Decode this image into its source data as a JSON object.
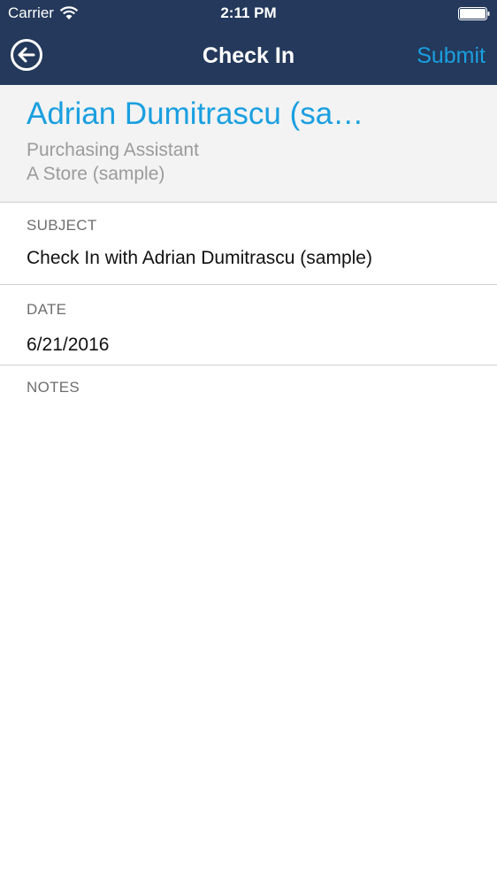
{
  "status_bar": {
    "carrier": "Carrier",
    "time": "2:11 PM"
  },
  "nav": {
    "back_icon": "back-arrow-circle-icon",
    "title": "Check In",
    "submit_label": "Submit"
  },
  "contact": {
    "name": "Adrian Dumitrascu (sample)",
    "title": "Purchasing Assistant",
    "account": "A Store (sample)"
  },
  "form": {
    "subject_label": "SUBJECT",
    "subject_value": "Check In with Adrian Dumitrascu (sample)",
    "date_label": "DATE",
    "date_value": "6/21/2016",
    "notes_label": "NOTES",
    "notes_value": ""
  },
  "colors": {
    "nav_background": "#24395b",
    "accent": "#1a9fe0",
    "header_background": "#f3f3f3"
  }
}
